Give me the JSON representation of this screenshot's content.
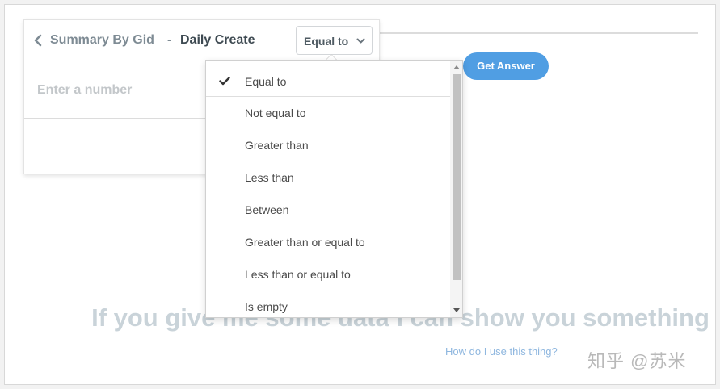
{
  "breadcrumb": {
    "parent": "Summary By Gid",
    "separator": "-",
    "current": "Daily Create"
  },
  "filter": {
    "operator_selected": "Equal to",
    "input_placeholder": "Enter a number",
    "input_value": ""
  },
  "actions": {
    "get_answer_label": "Get Answer"
  },
  "dropdown": {
    "options": [
      {
        "label": "Equal to",
        "selected": true
      },
      {
        "label": "Not equal to",
        "selected": false
      },
      {
        "label": "Greater than",
        "selected": false
      },
      {
        "label": "Less than",
        "selected": false
      },
      {
        "label": "Between",
        "selected": false
      },
      {
        "label": "Greater than or equal to",
        "selected": false
      },
      {
        "label": "Less than or equal to",
        "selected": false
      },
      {
        "label": "Is empty",
        "selected": false
      }
    ]
  },
  "empty_state": {
    "message": "If you give me some data I can show you something",
    "help_link": "How do I use this thing?"
  },
  "watermark": {
    "text": "知乎 @苏米"
  },
  "icons": {
    "back": "chevron-left-icon",
    "select": "chevron-down-icon",
    "selected_option": "checkmark-icon"
  },
  "colors": {
    "accent": "#509ee3",
    "empty_text": "#c9d3d9",
    "help_link": "#8fb7df"
  }
}
